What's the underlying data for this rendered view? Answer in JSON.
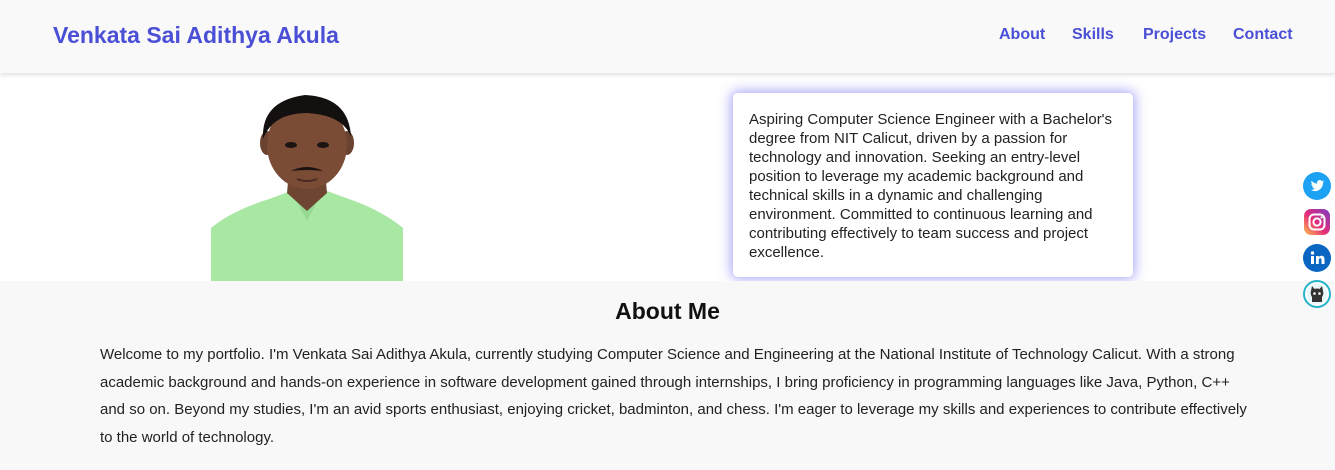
{
  "header": {
    "brand": "Venkata Sai Adithya Akula",
    "nav": [
      {
        "label": "About"
      },
      {
        "label": "Skills"
      },
      {
        "label": "Projects"
      },
      {
        "label": "Contact"
      }
    ]
  },
  "hero": {
    "photo_alt": "Venkata Sai Adithya Akula",
    "intro": "Aspiring Computer Science Engineer with a Bachelor's degree from NIT Calicut, driven by a passion for technology and innovation. Seeking an entry-level position to leverage my academic background and technical skills in a dynamic and challenging environment. Committed to continuous learning and contributing effectively to team success and project excellence."
  },
  "about": {
    "title": "About Me",
    "text": "Welcome to my portfolio. I'm Venkata Sai Adithya Akula, currently studying Computer Science and Engineering at the National Institute of Technology Calicut. With a strong academic background and hands-on experience in software development gained through internships, I bring proficiency in programming languages like Java, Python, C++ and so on. Beyond my studies, I'm an avid sports enthusiast, enjoying cricket, badminton, and chess. I'm eager to leverage my skills and experiences to contribute effectively to the world of technology."
  },
  "social": [
    {
      "icon": "twitter-icon",
      "color": "#1da1f2"
    },
    {
      "icon": "instagram-icon",
      "color": "#d6249f"
    },
    {
      "icon": "linkedin-icon",
      "color": "#0a66c2"
    },
    {
      "icon": "github-icon",
      "color": "#26b3c9"
    }
  ],
  "colors": {
    "accent": "#4a4fd6",
    "card_glow": "#5f5ff0"
  }
}
